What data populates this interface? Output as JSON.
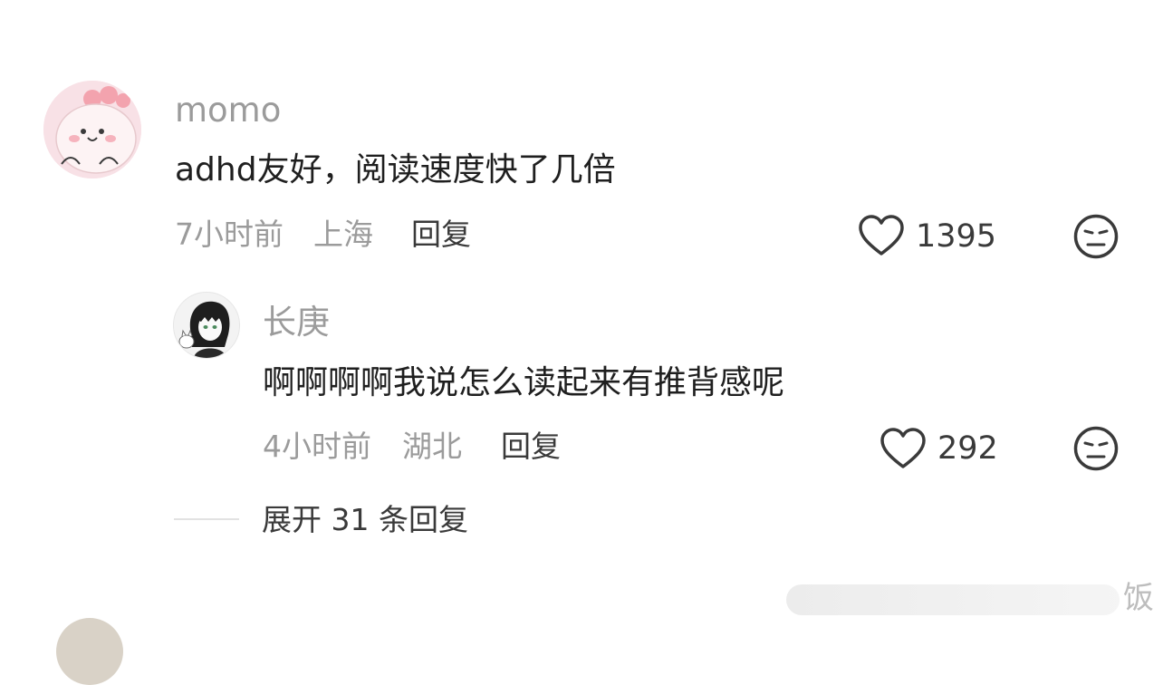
{
  "comments": [
    {
      "username": "momo",
      "text": "adhd友好，阅读速度快了几倍",
      "time": "7小时前",
      "location": "上海",
      "reply_label": "回复",
      "likes": "1395"
    }
  ],
  "reply": {
    "username": "长庚",
    "text": "啊啊啊啊我说怎么读起来有推背感呢",
    "time": "4小时前",
    "location": "湖北",
    "reply_label": "回复",
    "likes": "292"
  },
  "expand_label": "展开 31 条回复",
  "watermark": {
    "char": "饭"
  },
  "icons": {
    "like": "heart-outline-icon",
    "dislike": "neutral-face-icon"
  },
  "colors": {
    "text_primary": "#1f1f1f",
    "text_secondary": "#9b9b9b",
    "text_action": "#3a3a3a"
  }
}
